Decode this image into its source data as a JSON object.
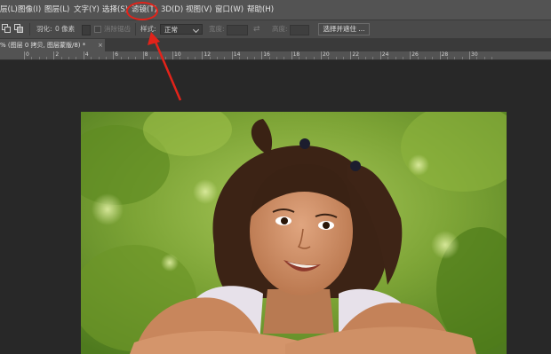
{
  "menubar": {
    "items": [
      {
        "id": "layer-partial",
        "label": "层(L)"
      },
      {
        "id": "image",
        "label": "图像(I)"
      },
      {
        "id": "layer",
        "label": "图层(L)"
      },
      {
        "id": "type",
        "label": "文字(Y)"
      },
      {
        "id": "select",
        "label": "选择(S)"
      },
      {
        "id": "filter",
        "label": "滤镜(T)"
      },
      {
        "id": "3d",
        "label": "3D(D)"
      },
      {
        "id": "view",
        "label": "视图(V)"
      },
      {
        "id": "window",
        "label": "窗口(W)"
      },
      {
        "id": "help",
        "label": "帮助(H)"
      }
    ],
    "highlighted_item": "filter"
  },
  "options": {
    "feather_label": "羽化:",
    "feather_value": "0 像素",
    "antialias_label": "消除锯齿",
    "style_label": "样式:",
    "style_value": "正常",
    "width_label": "宽度:",
    "height_label": "高度:",
    "select_mask_button": "选择并遮住 ..."
  },
  "document_tab": {
    "title": "% (图层 0 拷贝, 图层蒙版/8) *",
    "close_glyph": "×"
  },
  "ruler": {
    "labels": [
      "0",
      "2",
      "4",
      "6",
      "8",
      "10",
      "12",
      "14",
      "16",
      "18",
      "20",
      "22",
      "24",
      "26",
      "28",
      "30"
    ]
  },
  "colors": {
    "annotation": "#e2231a",
    "menubar_bg": "#535353",
    "workspace_bg": "#282828"
  }
}
